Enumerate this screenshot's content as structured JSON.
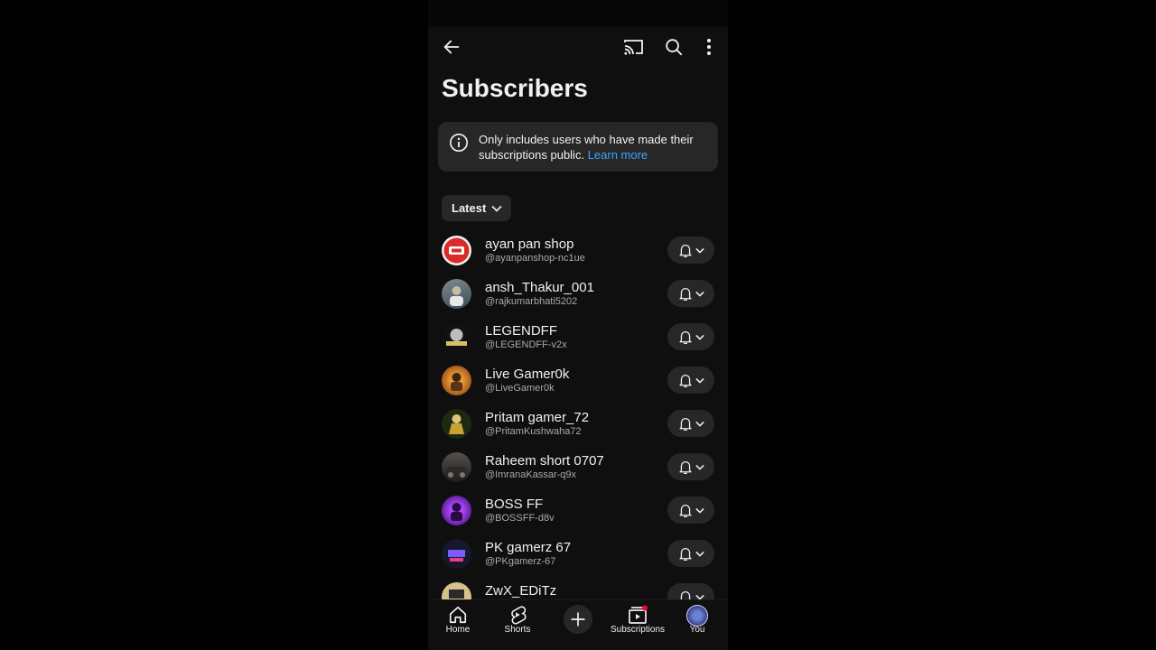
{
  "header": {
    "title": "Subscribers"
  },
  "notice": {
    "text": "Only includes users who have made their subscriptions public.",
    "link": "Learn more"
  },
  "filter": {
    "selected": "Latest"
  },
  "subscribers": [
    {
      "name": "ayan pan shop",
      "handle": "@ayanpanshop-nc1ue"
    },
    {
      "name": "ansh_Thakur_001",
      "handle": "@rajkumarbhati5202"
    },
    {
      "name": "LEGENDFF",
      "handle": "@LEGENDFF-v2x"
    },
    {
      "name": "Live Gamer0k",
      "handle": "@LiveGamer0k"
    },
    {
      "name": "Pritam gamer_72",
      "handle": "@PritamKushwaha72"
    },
    {
      "name": "Raheem short 0707",
      "handle": "@ImranaKassar-q9x"
    },
    {
      "name": "BOSS FF",
      "handle": "@BOSSFF-d8v"
    },
    {
      "name": "PK gamerz 67",
      "handle": "@PKgamerz-67"
    },
    {
      "name": "ZwX_EDiTz",
      "handle": ""
    }
  ],
  "nav": {
    "home": "Home",
    "shorts": "Shorts",
    "subscriptions": "Subscriptions",
    "you": "You"
  },
  "colors": {
    "background": "#0f0f0f",
    "surface": "#272727",
    "link": "#3ea6ff",
    "notification_dot": "#ff0033"
  }
}
